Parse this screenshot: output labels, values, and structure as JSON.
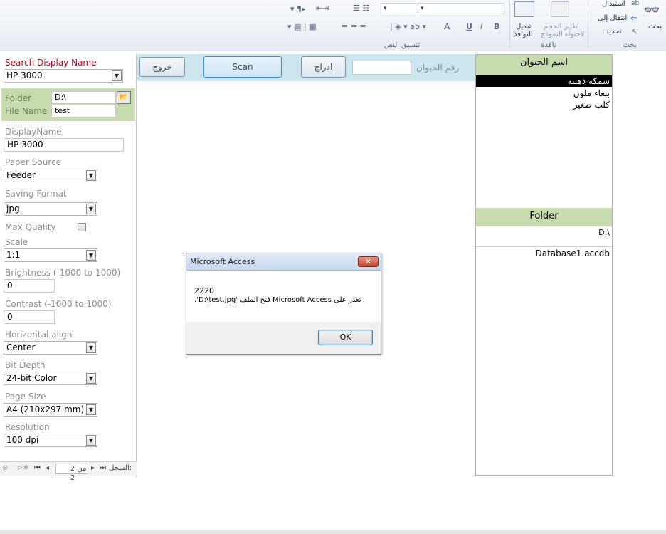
{
  "ribbon": {
    "search": {
      "group_label": "بحث",
      "find_label": "بحث",
      "replace_label": "استبدال",
      "goto_label": "انتقال إلى",
      "select_label": "تحديد"
    },
    "window": {
      "group_label": "نافذة",
      "resize_label_1": "تغيير الحجم",
      "resize_label_2": "لاحتواء النموذج",
      "switch_label_1": "تبديل",
      "switch_label_2": "النوافذ"
    },
    "text_format": {
      "group_label": "تنسيق النص"
    }
  },
  "form": {
    "search_display_name_label": "Search Display Name",
    "search_display_name_value": "HP 3000",
    "folder_label": "Folder",
    "folder_value": "D:\\",
    "file_name_label": "File Name",
    "file_name_value": "test",
    "display_name_label": "DisplayName",
    "display_name_value": "HP 3000",
    "paper_source_label": "Paper Source",
    "paper_source_value": "Feeder",
    "saving_format_label": "Saving Format",
    "saving_format_value": "jpg",
    "max_quality_label": "Max Quality",
    "scale_label": "Scale",
    "scale_value": "1:1",
    "brightness_label": "Brightness (-1000 to 1000)",
    "brightness_value": "0",
    "contrast_label": "Contrast   (-1000 to 1000)",
    "contrast_value": "0",
    "horizontal_align_label": "Horizontal align",
    "horizontal_align_value": "Center",
    "bit_depth_label": "Bit Depth",
    "bit_depth_value": "24-bit Color",
    "page_size_label": "Page Size",
    "page_size_value": "A4 (210x297 mm)",
    "resolution_label": "Resolution",
    "resolution_value": "100 dpi"
  },
  "navigator": {
    "record_label": "السجل:",
    "record_value": "2 من 2"
  },
  "toolbar": {
    "exit_label": "خروج",
    "scan_label": "Scan",
    "insert_label": "ادراج",
    "animal_number_label": "رقم الحيوان"
  },
  "right_panel": {
    "animal_name_header": "اسم الحيوان",
    "animals": [
      "سمكة ذهبية",
      "ببغاء ملون",
      "كلب صغير"
    ],
    "folder_header": "Folder",
    "folder_path": "D:\\",
    "database_name": "Database1.accdb"
  },
  "dialog": {
    "title": "Microsoft Access",
    "close_label": "✕",
    "error_code": "2220",
    "message": "تعذر على Microsoft Access فتح الملف 'D:\\test.jpg'.",
    "ok_label": "OK"
  },
  "colors": {
    "section_green": "#c7dcac",
    "toolbar_blue": "#cbe6ec",
    "required_label_red": "#c0001a"
  }
}
